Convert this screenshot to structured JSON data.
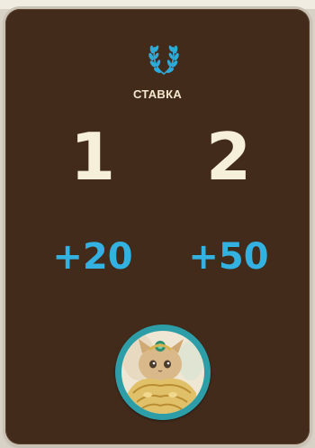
{
  "bet": {
    "label": "СТАВКА",
    "icon": "laurel-icon"
  },
  "options": [
    {
      "value": "1",
      "bonus": "+20"
    },
    {
      "value": "2",
      "bonus": "+50"
    }
  ],
  "avatar": {
    "icon": "cat-avatar"
  },
  "colors": {
    "card": "#422b1b",
    "number": "#f6efd9",
    "bonus": "#33b2e2",
    "accent": "#2d9ea8"
  }
}
